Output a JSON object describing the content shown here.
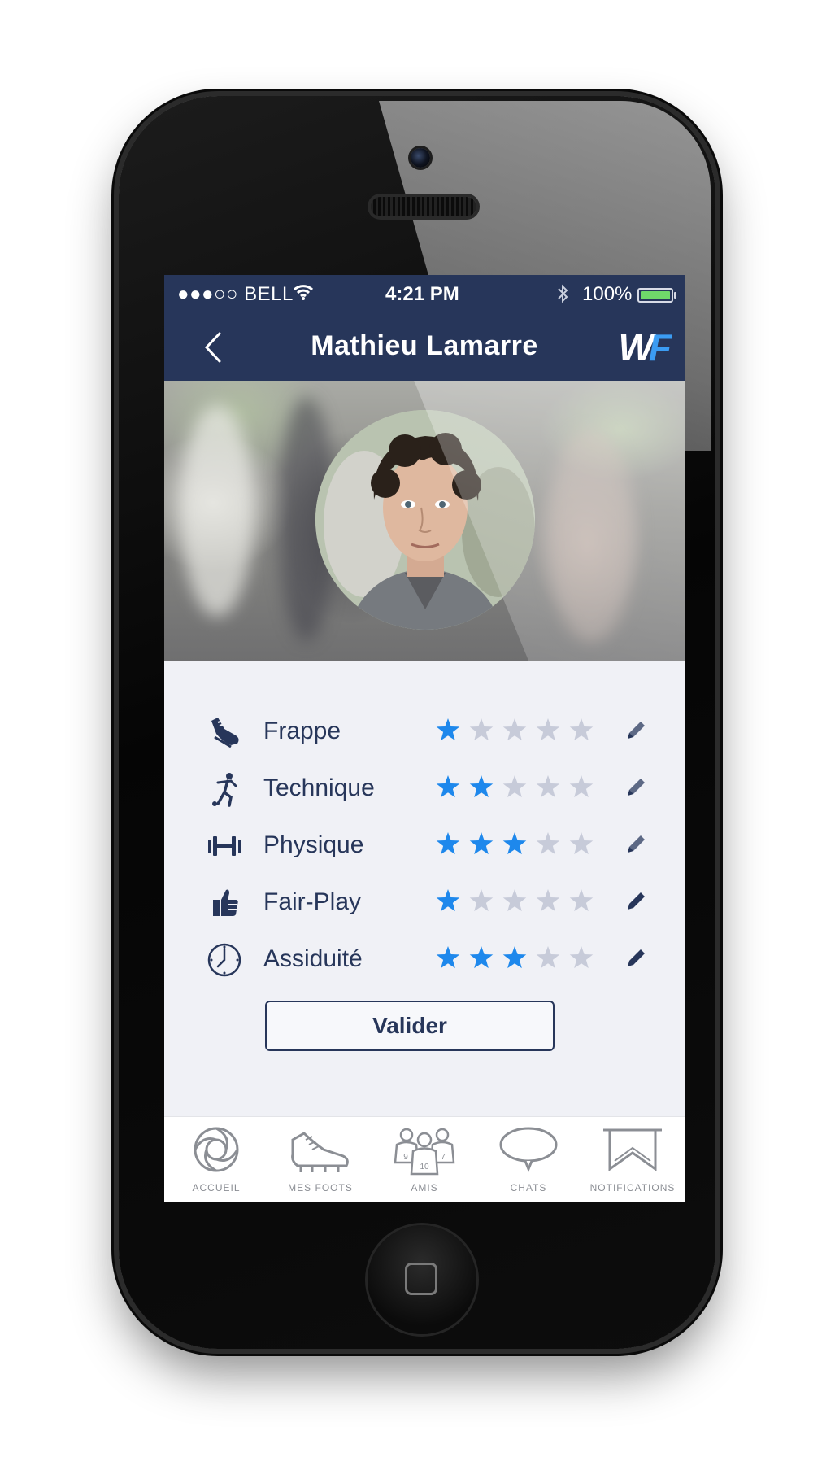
{
  "status_bar": {
    "carrier": "●●●○○ BELL",
    "time": "4:21 PM",
    "battery_text": "100%",
    "battery_color": "#6fd86a"
  },
  "nav": {
    "back_icon": "chevron-left-icon",
    "title": "Mathieu Lamarre",
    "logo_w": "W",
    "logo_f": "F",
    "bar_color": "#27365a",
    "logo_accent": "#3b9cf3"
  },
  "profile": {
    "avatar_icon": "profile-photo"
  },
  "ratings": [
    {
      "label": "Frappe",
      "icon": "football-boot-icon",
      "stars": 1,
      "max": 5
    },
    {
      "label": "Technique",
      "icon": "kicking-player-icon",
      "stars": 2,
      "max": 5
    },
    {
      "label": "Physique",
      "icon": "dumbbell-icon",
      "stars": 3,
      "max": 5
    },
    {
      "label": "Fair-Play",
      "icon": "thumbs-up-icon",
      "stars": 1,
      "max": 5
    },
    {
      "label": "Assiduité",
      "icon": "clock-icon",
      "stars": 3,
      "max": 5
    }
  ],
  "star_colors": {
    "filled": "#1e88ec",
    "empty": "#c7cbd9"
  },
  "validate_button": "Valider",
  "tabbar": [
    {
      "label": "ACCUEIL",
      "icon": "home-swirl-icon"
    },
    {
      "label": "MES FOOTS",
      "icon": "football-boot-icon"
    },
    {
      "label": "AMIS",
      "icon": "friends-icon",
      "jersey_numbers": [
        "9",
        "10",
        "7"
      ]
    },
    {
      "label": "CHATS",
      "icon": "chat-bubble-icon"
    },
    {
      "label": "NOTIFICATIONS",
      "icon": "bookmark-icon"
    }
  ]
}
